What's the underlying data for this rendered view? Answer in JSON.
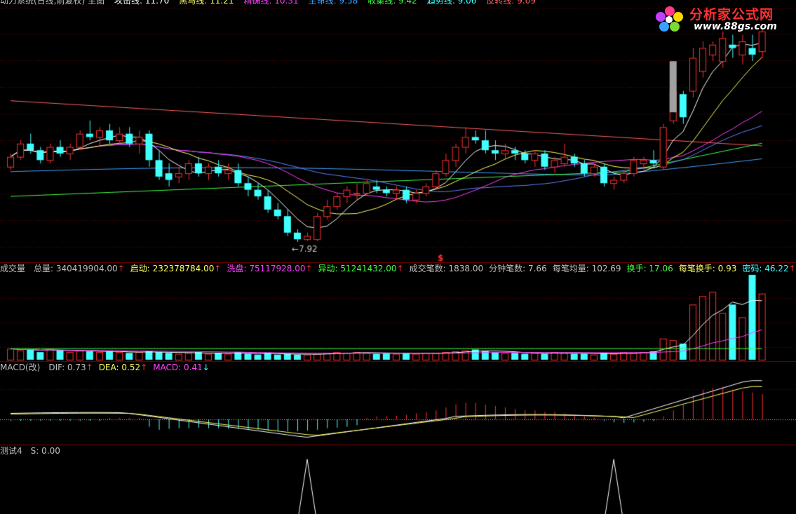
{
  "colors": {
    "up": "#ff3030",
    "down": "#40ffff",
    "ma5": "#ffffff",
    "ma10": "#ffff60",
    "ma20": "#ff40ff",
    "ma30": "#40ff40",
    "ma60": "#6080ff",
    "ma120": "#40a0ff",
    "ma250": "#ff6060",
    "grid": "#800000",
    "zero": "#b0b0b0"
  },
  "top_legend": [
    {
      "text": "动力系统(日线,前复权) 主图",
      "color": "#c0c0c0"
    },
    {
      "text": "攻击线: 11.70",
      "color": "#ffffff"
    },
    {
      "text": "黑马线: 11.21",
      "color": "#ffff60"
    },
    {
      "text": "精确线: 10.31",
      "color": "#ff40ff"
    },
    {
      "text": "生命线: 9.58",
      "color": "#40a0ff"
    },
    {
      "text": "收集线: 9.42",
      "color": "#40ff40"
    },
    {
      "text": "趋势线: 9.06",
      "color": "#40ffff"
    },
    {
      "text": "反转线: 9.09",
      "color": "#ff6060"
    }
  ],
  "watermark": {
    "title": "分析家公式网",
    "url": "www.88gs.com"
  },
  "price_panel": {
    "low_label": "←7.92",
    "marker": "$"
  },
  "volume_panel": {
    "name": "成交量",
    "items": [
      {
        "label": "总量: ",
        "value": "340419904.00",
        "color": "#c0c0c0",
        "arrow": "↑"
      },
      {
        "label": "启动: ",
        "value": "232378784.00",
        "color": "#ffff60",
        "arrow": "↑"
      },
      {
        "label": "洗盘: ",
        "value": "75117928.00",
        "color": "#ff40ff",
        "arrow": "↑"
      },
      {
        "label": "异动: ",
        "value": "51241432.00",
        "color": "#40ff40",
        "arrow": "↑"
      },
      {
        "label": "成交笔数: ",
        "value": "1838.00",
        "color": "#c0c0c0",
        "arrow": ""
      },
      {
        "label": "分钟笔数: ",
        "value": "7.66",
        "color": "#c0c0c0",
        "arrow": ""
      },
      {
        "label": "每笔均量: ",
        "value": "102.69",
        "color": "#c0c0c0",
        "arrow": ""
      },
      {
        "label": "换手: ",
        "value": "17.06",
        "color": "#40ff40",
        "arrow": ""
      },
      {
        "label": "每笔换手: ",
        "value": "0.93",
        "color": "#ffff60",
        "arrow": ""
      },
      {
        "label": "密码: ",
        "value": "46.22",
        "color": "#40ffff",
        "arrow": "↑"
      }
    ]
  },
  "macd_panel": {
    "name": "MACD(改)",
    "items": [
      {
        "label": "DIF: ",
        "value": "0.73",
        "color": "#c0c0c0",
        "arrow": "↑"
      },
      {
        "label": "DEA: ",
        "value": "0.52",
        "color": "#ffff60",
        "arrow": "↑"
      },
      {
        "label": "MACD: ",
        "value": "0.41",
        "color": "#ff40ff",
        "arrow": "↓"
      }
    ]
  },
  "test_panel": {
    "name": "测试4",
    "items": [
      {
        "label": "S: ",
        "value": "0.00",
        "color": "#c0c0c0",
        "arrow": ""
      }
    ]
  },
  "chart_data": {
    "type": "candlestick",
    "candles": [
      [
        10.2,
        10.6,
        10.1,
        10.5
      ],
      [
        10.5,
        11.0,
        10.4,
        10.9
      ],
      [
        10.9,
        11.2,
        10.6,
        10.7
      ],
      [
        10.7,
        10.8,
        10.3,
        10.4
      ],
      [
        10.4,
        10.9,
        10.3,
        10.8
      ],
      [
        10.8,
        11.0,
        10.5,
        10.6
      ],
      [
        10.6,
        10.9,
        10.4,
        10.8
      ],
      [
        10.8,
        11.3,
        10.7,
        11.2
      ],
      [
        11.2,
        11.6,
        11.0,
        11.1
      ],
      [
        11.1,
        11.4,
        10.8,
        11.3
      ],
      [
        11.3,
        11.5,
        10.9,
        11.0
      ],
      [
        11.0,
        11.4,
        10.9,
        11.2
      ],
      [
        11.2,
        11.4,
        10.8,
        10.9
      ],
      [
        10.9,
        11.3,
        10.6,
        11.1
      ],
      [
        11.2,
        11.3,
        10.2,
        10.4
      ],
      [
        10.4,
        10.7,
        9.8,
        9.9
      ],
      [
        10.0,
        10.3,
        9.6,
        9.8
      ],
      [
        9.9,
        10.2,
        9.7,
        10.0
      ],
      [
        10.0,
        10.4,
        9.8,
        10.3
      ],
      [
        10.3,
        10.5,
        9.9,
        10.0
      ],
      [
        10.0,
        10.3,
        9.8,
        10.2
      ],
      [
        10.2,
        10.4,
        9.9,
        10.0
      ],
      [
        10.0,
        10.3,
        9.8,
        10.1
      ],
      [
        10.1,
        10.3,
        9.6,
        9.7
      ],
      [
        9.7,
        9.9,
        9.3,
        9.5
      ],
      [
        9.5,
        9.7,
        9.2,
        9.3
      ],
      [
        9.3,
        9.5,
        8.8,
        8.9
      ],
      [
        8.9,
        9.1,
        8.6,
        8.7
      ],
      [
        8.7,
        8.9,
        8.1,
        8.2
      ],
      [
        8.2,
        8.3,
        7.92,
        8.0
      ],
      [
        8.0,
        8.2,
        7.95,
        8.1
      ],
      [
        8.0,
        8.8,
        7.95,
        8.7
      ],
      [
        8.7,
        9.2,
        8.6,
        9.0
      ],
      [
        9.0,
        9.4,
        8.9,
        9.3
      ],
      [
        9.3,
        9.6,
        9.1,
        9.5
      ],
      [
        9.4,
        9.7,
        9.2,
        9.4
      ],
      [
        9.4,
        9.8,
        9.3,
        9.7
      ],
      [
        9.6,
        9.8,
        9.4,
        9.5
      ],
      [
        9.5,
        9.6,
        9.3,
        9.4
      ],
      [
        9.4,
        9.6,
        9.2,
        9.5
      ],
      [
        9.5,
        9.6,
        9.1,
        9.2
      ],
      [
        9.2,
        9.5,
        9.1,
        9.4
      ],
      [
        9.4,
        9.7,
        9.3,
        9.6
      ],
      [
        9.6,
        10.1,
        9.5,
        10.0
      ],
      [
        10.0,
        10.6,
        9.9,
        10.4
      ],
      [
        10.4,
        10.9,
        10.2,
        10.8
      ],
      [
        10.8,
        11.4,
        10.6,
        11.1
      ],
      [
        11.1,
        11.3,
        10.9,
        11.0
      ],
      [
        11.0,
        11.3,
        10.6,
        10.7
      ],
      [
        10.7,
        11.0,
        10.4,
        10.6
      ],
      [
        10.6,
        10.9,
        10.4,
        10.7
      ],
      [
        10.7,
        10.8,
        10.4,
        10.6
      ],
      [
        10.6,
        10.7,
        10.3,
        10.4
      ],
      [
        10.4,
        10.7,
        10.2,
        10.6
      ],
      [
        10.6,
        10.7,
        10.1,
        10.2
      ],
      [
        10.2,
        10.5,
        10.0,
        10.4
      ],
      [
        10.3,
        10.9,
        10.2,
        10.5
      ],
      [
        10.5,
        10.6,
        10.2,
        10.3
      ],
      [
        10.3,
        10.4,
        9.9,
        10.0
      ],
      [
        10.0,
        10.3,
        9.9,
        10.2
      ],
      [
        10.2,
        10.3,
        9.6,
        9.7
      ],
      [
        9.7,
        9.9,
        9.5,
        9.8
      ],
      [
        9.8,
        10.1,
        9.7,
        10.0
      ],
      [
        10.0,
        10.5,
        9.9,
        10.4
      ],
      [
        10.3,
        10.5,
        10.1,
        10.4
      ],
      [
        10.4,
        10.7,
        10.2,
        10.3
      ],
      [
        10.2,
        11.5,
        10.1,
        11.4
      ],
      [
        11.6,
        12.9,
        11.5,
        12.5
      ],
      [
        12.4,
        12.5,
        11.5,
        11.7
      ],
      [
        12.5,
        13.8,
        12.3,
        13.5
      ],
      [
        13.1,
        14.0,
        12.9,
        13.8
      ],
      [
        13.6,
        14.0,
        13.4,
        13.9
      ],
      [
        13.4,
        14.3,
        13.2,
        14.1
      ],
      [
        13.9,
        14.2,
        13.5,
        13.8
      ],
      [
        13.6,
        14.2,
        13.3,
        14.0
      ],
      [
        13.8,
        14.2,
        13.4,
        13.6
      ],
      [
        13.7,
        14.4,
        13.5,
        14.3
      ]
    ],
    "volume": [
      13,
      11,
      12,
      9,
      13,
      11,
      9,
      11,
      10,
      9,
      10,
      9,
      8,
      9,
      10,
      9,
      8,
      7,
      8,
      9,
      7,
      8,
      7,
      9,
      7,
      6,
      8,
      6,
      7,
      6,
      6,
      7,
      8,
      9,
      8,
      9,
      8,
      7,
      8,
      7,
      8,
      7,
      8,
      8,
      9,
      10,
      11,
      12,
      10,
      9,
      8,
      8,
      7,
      8,
      7,
      9,
      8,
      7,
      7,
      6,
      8,
      7,
      9,
      8,
      9,
      10,
      25,
      23,
      19,
      65,
      75,
      80,
      55,
      65,
      50,
      100,
      78
    ],
    "volume_ylim": [
      0,
      100
    ],
    "macd": [
      -0.05,
      -0.05,
      -0.05,
      -0.05,
      -0.05,
      -0.05,
      -0.05,
      -0.05,
      -0.05,
      -0.05,
      0.05,
      0.05,
      0.05,
      0.05,
      -0.25,
      -0.35,
      -0.32,
      -0.3,
      -0.3,
      -0.28,
      -0.3,
      -0.3,
      -0.32,
      -0.32,
      -0.35,
      -0.35,
      -0.38,
      -0.4,
      -0.4,
      -0.4,
      -0.38,
      -0.35,
      -0.3,
      -0.28,
      -0.25,
      -0.2,
      0.05,
      0.1,
      0.1,
      0.12,
      0.15,
      0.2,
      0.25,
      0.3,
      0.4,
      0.5,
      0.55,
      0.55,
      0.5,
      0.45,
      0.4,
      0.35,
      0.3,
      0.3,
      0.25,
      0.25,
      0.2,
      0.15,
      0.1,
      0.05,
      -0.05,
      -0.1,
      -0.12,
      -0.1,
      -0.08,
      -0.05,
      0.1,
      0.3,
      0.5,
      0.8,
      1.0,
      1.05,
      1.1,
      1.0,
      0.95,
      0.9,
      0.85
    ],
    "macd_ylim": [
      -0.8,
      1.6
    ],
    "signal_peaks": [
      30,
      61
    ]
  }
}
